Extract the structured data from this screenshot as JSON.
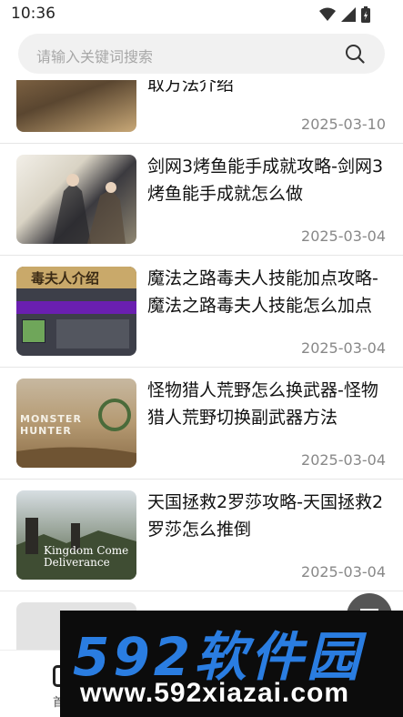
{
  "status_bar": {
    "time": "10:36"
  },
  "search": {
    "placeholder": "请输入关键词搜索"
  },
  "articles": [
    {
      "title": "将-怪物猎人荒野宝石装备获取方法介绍",
      "title_visible": "取方法介绍",
      "date": "2025-03-10",
      "thumb_icon": "game-art-thumbnail"
    },
    {
      "title": "剑网3烤鱼能手成就攻略-剑网3烤鱼能手成就怎么做",
      "date": "2025-03-04",
      "thumb_icon": "jx3-poster-thumbnail"
    },
    {
      "title": "魔法之路毒夫人技能加点攻略-魔法之路毒夫人技能怎么加点",
      "date": "2025-03-04",
      "thumb_icon": "skill-guide-thumbnail",
      "thumb_caption": "毒夫人介绍"
    },
    {
      "title": "怪物猎人荒野怎么换武器-怪物猎人荒野切换副武器方法",
      "date": "2025-03-04",
      "thumb_icon": "monster-hunter-thumbnail",
      "thumb_caption": "MONSTER HUNTER"
    },
    {
      "title": "天国拯救2罗莎攻略-天国拯救2罗莎怎么推倒",
      "date": "2025-03-04",
      "thumb_icon": "kingdom-come-thumbnail",
      "thumb_caption": "Kingdom Come Deliverance"
    }
  ],
  "bottom_nav": {
    "first_label": "首"
  },
  "watermark": {
    "brand": "592软件园",
    "url": "www.592xiazai.com"
  },
  "colors": {
    "accent": "#2a7de1",
    "date": "#888888",
    "divider": "#e6e6e6"
  }
}
